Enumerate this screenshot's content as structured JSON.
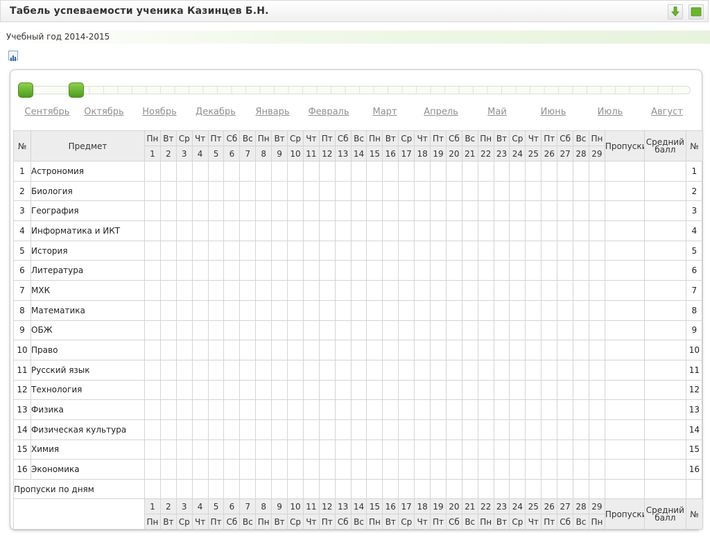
{
  "header": {
    "title": "Табель успеваемости ученика Казинцев Б.Н."
  },
  "year": "Учебный год 2014-2015",
  "months": [
    "Сентябрь",
    "Октябрь",
    "Ноябрь",
    "Декабрь",
    "Январь",
    "Февраль",
    "Март",
    "Апрель",
    "Май",
    "Июнь",
    "Июль",
    "Август"
  ],
  "table": {
    "col_num": "№",
    "col_subject": "Предмет",
    "col_absences": "Пропуски",
    "col_avg": "Средний балл",
    "col_num_right": "№",
    "weekdays": [
      "Пн",
      "Вт",
      "Ср",
      "Чт",
      "Пт",
      "Сб",
      "Вс",
      "Пн",
      "Вт",
      "Ср",
      "Чт",
      "Пт",
      "Сб",
      "Вс",
      "Пн",
      "Вт",
      "Ср",
      "Чт",
      "Пт",
      "Сб",
      "Вс",
      "Пн",
      "Вт",
      "Ср",
      "Чт",
      "Пт",
      "Сб",
      "Вс",
      "Пн"
    ],
    "days": [
      "1",
      "2",
      "3",
      "4",
      "5",
      "6",
      "7",
      "8",
      "9",
      "10",
      "11",
      "12",
      "13",
      "14",
      "15",
      "16",
      "17",
      "18",
      "19",
      "20",
      "21",
      "22",
      "23",
      "24",
      "25",
      "26",
      "27",
      "28",
      "29"
    ],
    "rows": [
      {
        "n": "1",
        "subject": "Астрономия"
      },
      {
        "n": "2",
        "subject": "Биология"
      },
      {
        "n": "3",
        "subject": "География"
      },
      {
        "n": "4",
        "subject": "Информатика и ИКТ"
      },
      {
        "n": "5",
        "subject": "История"
      },
      {
        "n": "6",
        "subject": "Литература"
      },
      {
        "n": "7",
        "subject": "МХК"
      },
      {
        "n": "8",
        "subject": "Математика"
      },
      {
        "n": "9",
        "subject": "ОБЖ"
      },
      {
        "n": "10",
        "subject": "Право"
      },
      {
        "n": "11",
        "subject": "Русский язык"
      },
      {
        "n": "12",
        "subject": "Технология"
      },
      {
        "n": "13",
        "subject": "Физика"
      },
      {
        "n": "14",
        "subject": "Физическая культура"
      },
      {
        "n": "15",
        "subject": "Химия"
      },
      {
        "n": "16",
        "subject": "Экономика"
      }
    ],
    "absences_by_day": "Пропуски по дням"
  }
}
